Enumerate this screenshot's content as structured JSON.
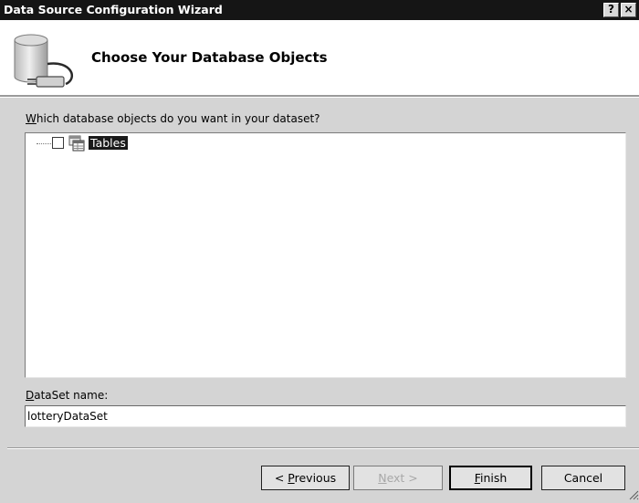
{
  "window": {
    "title": "Data Source Configuration Wizard",
    "help_glyph": "?",
    "close_glyph": "×"
  },
  "header": {
    "heading": "Choose Your Database Objects",
    "icon": "database-plug-icon"
  },
  "objects": {
    "question": "Which database objects do you want in your dataset?",
    "tree": [
      {
        "label": "Tables",
        "checked": false,
        "icon": "tables-icon",
        "selected": true
      }
    ]
  },
  "dataset": {
    "label": "DataSet name:",
    "value": "lotteryDataSet"
  },
  "buttons": {
    "previous": "< Previous",
    "next": "Next >",
    "finish": "Finish",
    "cancel": "Cancel"
  }
}
